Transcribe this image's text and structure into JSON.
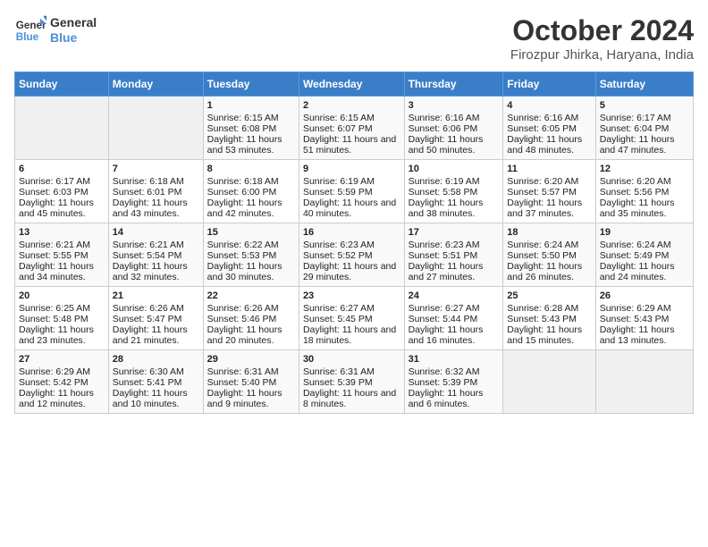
{
  "logo": {
    "line1": "General",
    "line2": "Blue"
  },
  "title": "October 2024",
  "subtitle": "Firozpur Jhirka, Haryana, India",
  "days_header": [
    "Sunday",
    "Monday",
    "Tuesday",
    "Wednesday",
    "Thursday",
    "Friday",
    "Saturday"
  ],
  "weeks": [
    [
      {
        "day": "",
        "data": ""
      },
      {
        "day": "",
        "data": ""
      },
      {
        "day": "1",
        "data": "Sunrise: 6:15 AM\nSunset: 6:08 PM\nDaylight: 11 hours and 53 minutes."
      },
      {
        "day": "2",
        "data": "Sunrise: 6:15 AM\nSunset: 6:07 PM\nDaylight: 11 hours and 51 minutes."
      },
      {
        "day": "3",
        "data": "Sunrise: 6:16 AM\nSunset: 6:06 PM\nDaylight: 11 hours and 50 minutes."
      },
      {
        "day": "4",
        "data": "Sunrise: 6:16 AM\nSunset: 6:05 PM\nDaylight: 11 hours and 48 minutes."
      },
      {
        "day": "5",
        "data": "Sunrise: 6:17 AM\nSunset: 6:04 PM\nDaylight: 11 hours and 47 minutes."
      }
    ],
    [
      {
        "day": "6",
        "data": "Sunrise: 6:17 AM\nSunset: 6:03 PM\nDaylight: 11 hours and 45 minutes."
      },
      {
        "day": "7",
        "data": "Sunrise: 6:18 AM\nSunset: 6:01 PM\nDaylight: 11 hours and 43 minutes."
      },
      {
        "day": "8",
        "data": "Sunrise: 6:18 AM\nSunset: 6:00 PM\nDaylight: 11 hours and 42 minutes."
      },
      {
        "day": "9",
        "data": "Sunrise: 6:19 AM\nSunset: 5:59 PM\nDaylight: 11 hours and 40 minutes."
      },
      {
        "day": "10",
        "data": "Sunrise: 6:19 AM\nSunset: 5:58 PM\nDaylight: 11 hours and 38 minutes."
      },
      {
        "day": "11",
        "data": "Sunrise: 6:20 AM\nSunset: 5:57 PM\nDaylight: 11 hours and 37 minutes."
      },
      {
        "day": "12",
        "data": "Sunrise: 6:20 AM\nSunset: 5:56 PM\nDaylight: 11 hours and 35 minutes."
      }
    ],
    [
      {
        "day": "13",
        "data": "Sunrise: 6:21 AM\nSunset: 5:55 PM\nDaylight: 11 hours and 34 minutes."
      },
      {
        "day": "14",
        "data": "Sunrise: 6:21 AM\nSunset: 5:54 PM\nDaylight: 11 hours and 32 minutes."
      },
      {
        "day": "15",
        "data": "Sunrise: 6:22 AM\nSunset: 5:53 PM\nDaylight: 11 hours and 30 minutes."
      },
      {
        "day": "16",
        "data": "Sunrise: 6:23 AM\nSunset: 5:52 PM\nDaylight: 11 hours and 29 minutes."
      },
      {
        "day": "17",
        "data": "Sunrise: 6:23 AM\nSunset: 5:51 PM\nDaylight: 11 hours and 27 minutes."
      },
      {
        "day": "18",
        "data": "Sunrise: 6:24 AM\nSunset: 5:50 PM\nDaylight: 11 hours and 26 minutes."
      },
      {
        "day": "19",
        "data": "Sunrise: 6:24 AM\nSunset: 5:49 PM\nDaylight: 11 hours and 24 minutes."
      }
    ],
    [
      {
        "day": "20",
        "data": "Sunrise: 6:25 AM\nSunset: 5:48 PM\nDaylight: 11 hours and 23 minutes."
      },
      {
        "day": "21",
        "data": "Sunrise: 6:26 AM\nSunset: 5:47 PM\nDaylight: 11 hours and 21 minutes."
      },
      {
        "day": "22",
        "data": "Sunrise: 6:26 AM\nSunset: 5:46 PM\nDaylight: 11 hours and 20 minutes."
      },
      {
        "day": "23",
        "data": "Sunrise: 6:27 AM\nSunset: 5:45 PM\nDaylight: 11 hours and 18 minutes."
      },
      {
        "day": "24",
        "data": "Sunrise: 6:27 AM\nSunset: 5:44 PM\nDaylight: 11 hours and 16 minutes."
      },
      {
        "day": "25",
        "data": "Sunrise: 6:28 AM\nSunset: 5:43 PM\nDaylight: 11 hours and 15 minutes."
      },
      {
        "day": "26",
        "data": "Sunrise: 6:29 AM\nSunset: 5:43 PM\nDaylight: 11 hours and 13 minutes."
      }
    ],
    [
      {
        "day": "27",
        "data": "Sunrise: 6:29 AM\nSunset: 5:42 PM\nDaylight: 11 hours and 12 minutes."
      },
      {
        "day": "28",
        "data": "Sunrise: 6:30 AM\nSunset: 5:41 PM\nDaylight: 11 hours and 10 minutes."
      },
      {
        "day": "29",
        "data": "Sunrise: 6:31 AM\nSunset: 5:40 PM\nDaylight: 11 hours and 9 minutes."
      },
      {
        "day": "30",
        "data": "Sunrise: 6:31 AM\nSunset: 5:39 PM\nDaylight: 11 hours and 8 minutes."
      },
      {
        "day": "31",
        "data": "Sunrise: 6:32 AM\nSunset: 5:39 PM\nDaylight: 11 hours and 6 minutes."
      },
      {
        "day": "",
        "data": ""
      },
      {
        "day": "",
        "data": ""
      }
    ]
  ]
}
